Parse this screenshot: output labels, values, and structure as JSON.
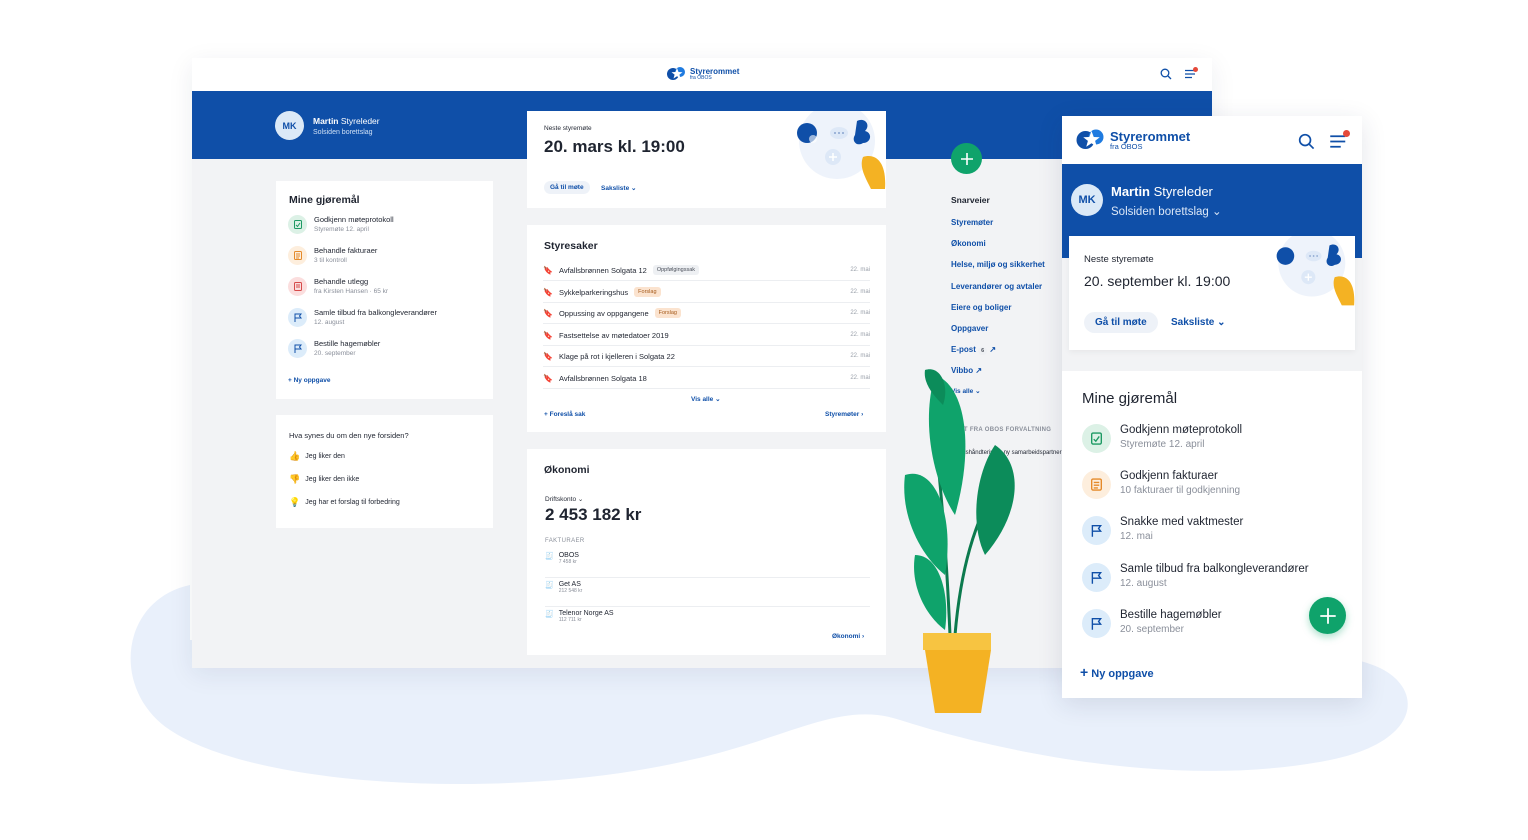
{
  "brand": {
    "name": "Styrerommet",
    "sub": "fra OBOS"
  },
  "colors": {
    "primary": "#0f4fa8",
    "green": "#0fa36b",
    "bg_blob": "#e9f0fb",
    "badge_orange": "#fbe3cf",
    "badge_gray": "#eef0f3"
  },
  "user": {
    "initials": "MK",
    "first_name": "Martin",
    "role": "Styreleder",
    "org": "Solsiden borettslag"
  },
  "desktop": {
    "meeting": {
      "label": "Neste styremøte",
      "time": "20. mars kl. 19:00",
      "go_button": "Gå til møte",
      "agenda": "Saksliste"
    },
    "tasks": {
      "title": "Mine gjøremål",
      "items": [
        {
          "title": "Godkjenn møteprotokoll",
          "sub": "Styremøte 12. april",
          "icon": "document-check-icon"
        },
        {
          "title": "Behandle fakturaer",
          "sub": "3 til kontroll",
          "icon": "invoice-icon"
        },
        {
          "title": "Behandle utlegg",
          "sub": "fra Kirsten Hansen · 65 kr",
          "icon": "receipt-icon"
        },
        {
          "title": "Samle tilbud fra balkongleverandører",
          "sub": "12. august",
          "icon": "flag-icon"
        },
        {
          "title": "Bestille hagemøbler",
          "sub": "20. september",
          "icon": "flag-icon"
        }
      ],
      "add": "Ny oppgave"
    },
    "feedback": {
      "question": "Hva synes du om den nye forsiden?",
      "options": [
        "Jeg liker den",
        "Jeg liker den ikke",
        "Jeg har et forslag til forbedring"
      ]
    },
    "cases": {
      "title": "Styresaker",
      "rows": [
        {
          "name": "Avfallsbrønnen Solgata 12",
          "badge": "Oppfølgingssak",
          "date": "22. mai"
        },
        {
          "name": "Sykkelparkeringshus",
          "badge": "Forslag",
          "date": "22. mai"
        },
        {
          "name": "Oppussing av oppgangene",
          "badge": "Forslag",
          "date": "22. mai"
        },
        {
          "name": "Fastsettelse av møtedatoer 2019",
          "badge": "",
          "date": "22. mai"
        },
        {
          "name": "Klage på rot i kjelleren i Solgata 22",
          "badge": "",
          "date": "22. mai"
        },
        {
          "name": "Avfallsbrønnen Solgata 18",
          "badge": "",
          "date": "22. mai"
        }
      ],
      "show_all": "Vis alle",
      "propose": "Foreslå sak",
      "meetings_link": "Styremøter"
    },
    "economy": {
      "title": "Økonomi",
      "account_label": "Driftskonto",
      "balance": "2 453 182 kr",
      "invoices_label": "FAKTURAER",
      "invoices": [
        {
          "name": "OBOS",
          "amount": "7 458 kr"
        },
        {
          "name": "Get AS",
          "amount": "212 548 kr"
        },
        {
          "name": "Telenor Norge AS",
          "amount": "112 711 kr"
        }
      ],
      "link": "Økonomi"
    },
    "shortcuts": {
      "title": "Snarveier",
      "links": [
        "Styremøter",
        "Økonomi",
        "Helse, miljø og sikkerhet",
        "Leverandører og avtaler",
        "Eiere og boliger",
        "Oppgaver",
        "E-post",
        "Vibbo"
      ],
      "email_count": "6",
      "show_all": "Vis alle",
      "news_header": "NYTT FRA OBOS FORVALTNING",
      "news_item": "Avfallshåndtering – ny samarbeidspartner"
    }
  },
  "mobile": {
    "meeting": {
      "label": "Neste styremøte",
      "time": "20. september kl. 19:00",
      "go_button": "Gå til møte",
      "agenda": "Saksliste"
    },
    "tasks": {
      "title": "Mine gjøremål",
      "items": [
        {
          "title": "Godkjenn møteprotokoll",
          "sub": "Styremøte 12. april",
          "icon": "document-check-icon"
        },
        {
          "title": "Godkjenn fakturaer",
          "sub": "10 fakturaer til godkjenning",
          "icon": "invoice-icon"
        },
        {
          "title": "Snakke med vaktmester",
          "sub": "12. mai",
          "icon": "flag-icon"
        },
        {
          "title": "Samle tilbud fra balkongleverandører",
          "sub": "12. august",
          "icon": "flag-icon"
        },
        {
          "title": "Bestille hagemøbler",
          "sub": "20. september",
          "icon": "flag-icon"
        }
      ],
      "add": "Ny oppgave"
    }
  }
}
